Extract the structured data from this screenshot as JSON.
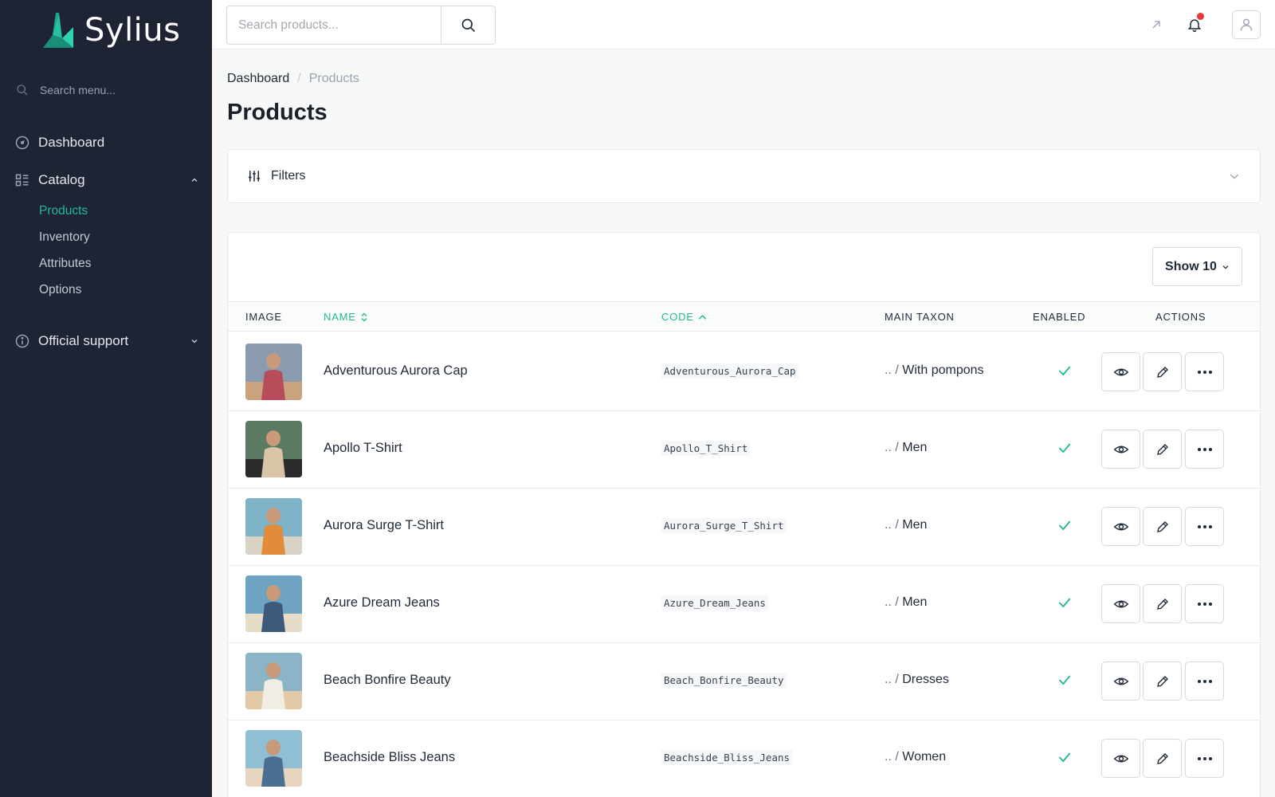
{
  "app": {
    "name": "Sylius"
  },
  "sidebar": {
    "search_placeholder": "Search menu...",
    "dashboard_label": "Dashboard",
    "catalog_label": "Catalog",
    "catalog_items": [
      "Products",
      "Inventory",
      "Attributes",
      "Options"
    ],
    "support_label": "Official support"
  },
  "topbar": {
    "search_placeholder": "Search products..."
  },
  "breadcrumb": {
    "root": "Dashboard",
    "separator": "/",
    "current": "Products"
  },
  "page": {
    "title": "Products"
  },
  "filters": {
    "label": "Filters"
  },
  "table": {
    "show_label": "Show 10",
    "columns": {
      "image": "IMAGE",
      "name": "NAME",
      "code": "CODE",
      "main_taxon": "MAIN TAXON",
      "enabled": "ENABLED",
      "actions": "ACTIONS"
    },
    "rows": [
      {
        "name": "Adventurous Aurora Cap",
        "code": "Adventurous_Aurora_Cap",
        "taxon_prefix": "..",
        "taxon_sep": "/",
        "taxon": "With pompons"
      },
      {
        "name": "Apollo T-Shirt",
        "code": "Apollo_T_Shirt",
        "taxon_prefix": "..",
        "taxon_sep": "/",
        "taxon": "Men"
      },
      {
        "name": "Aurora Surge T-Shirt",
        "code": "Aurora_Surge_T_Shirt",
        "taxon_prefix": "..",
        "taxon_sep": "/",
        "taxon": "Men"
      },
      {
        "name": "Azure Dream Jeans",
        "code": "Azure_Dream_Jeans",
        "taxon_prefix": "..",
        "taxon_sep": "/",
        "taxon": "Men"
      },
      {
        "name": "Beach Bonfire Beauty",
        "code": "Beach_Bonfire_Beauty",
        "taxon_prefix": "..",
        "taxon_sep": "/",
        "taxon": "Dresses"
      },
      {
        "name": "Beachside Bliss Jeans",
        "code": "Beachside_Bliss_Jeans",
        "taxon_prefix": "..",
        "taxon_sep": "/",
        "taxon": "Women"
      }
    ]
  },
  "colors": {
    "accent": "#22b99a",
    "sidebar_bg": "#1e2434",
    "notification": "#e53935"
  },
  "icons": [
    "search-icon",
    "dashboard-icon",
    "catalog-icon",
    "info-icon",
    "external-link-icon",
    "bell-icon",
    "user-icon",
    "filters-icon",
    "chevron-down-icon",
    "chevron-up-icon",
    "sort-icon",
    "check-icon",
    "eye-icon",
    "pencil-icon",
    "more-icon"
  ]
}
